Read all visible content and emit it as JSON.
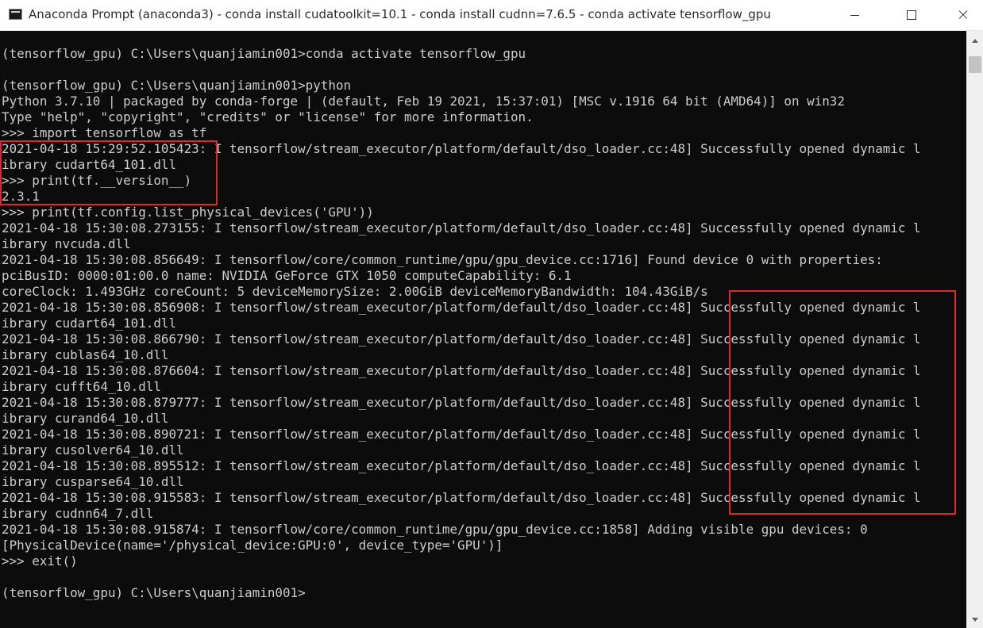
{
  "window": {
    "title": "Anaconda Prompt (anaconda3) - conda  install cudatoolkit=10.1 - conda  install cudnn=7.6.5 - conda  activate tensorflow_gpu",
    "app_icon": "console-icon",
    "controls": {
      "minimize": "minimize-icon",
      "maximize": "maximize-icon",
      "close": "close-icon"
    }
  },
  "console": {
    "background": "#0c0c0c",
    "foreground": "#cccccc",
    "lines": [
      "(tensorflow_gpu) C:\\Users\\quanjiamin001>conda activate tensorflow_gpu",
      "",
      "(tensorflow_gpu) C:\\Users\\quanjiamin001>python",
      "Python 3.7.10 | packaged by conda-forge | (default, Feb 19 2021, 15:37:01) [MSC v.1916 64 bit (AMD64)] on win32",
      "Type \"help\", \"copyright\", \"credits\" or \"license\" for more information.",
      ">>> import tensorflow as tf",
      "2021-04-18 15:29:52.105423: I tensorflow/stream_executor/platform/default/dso_loader.cc:48] Successfully opened dynamic l",
      "ibrary cudart64_101.dll",
      ">>> print(tf.__version__)",
      "2.3.1",
      ">>> print(tf.config.list_physical_devices('GPU'))",
      "2021-04-18 15:30:08.273155: I tensorflow/stream_executor/platform/default/dso_loader.cc:48] Successfully opened dynamic l",
      "ibrary nvcuda.dll",
      "2021-04-18 15:30:08.856649: I tensorflow/core/common_runtime/gpu/gpu_device.cc:1716] Found device 0 with properties:",
      "pciBusID: 0000:01:00.0 name: NVIDIA GeForce GTX 1050 computeCapability: 6.1",
      "coreClock: 1.493GHz coreCount: 5 deviceMemorySize: 2.00GiB deviceMemoryBandwidth: 104.43GiB/s",
      "2021-04-18 15:30:08.856908: I tensorflow/stream_executor/platform/default/dso_loader.cc:48] Successfully opened dynamic l",
      "ibrary cudart64_101.dll",
      "2021-04-18 15:30:08.866790: I tensorflow/stream_executor/platform/default/dso_loader.cc:48] Successfully opened dynamic l",
      "ibrary cublas64_10.dll",
      "2021-04-18 15:30:08.876604: I tensorflow/stream_executor/platform/default/dso_loader.cc:48] Successfully opened dynamic l",
      "ibrary cufft64_10.dll",
      "2021-04-18 15:30:08.879777: I tensorflow/stream_executor/platform/default/dso_loader.cc:48] Successfully opened dynamic l",
      "ibrary curand64_10.dll",
      "2021-04-18 15:30:08.890721: I tensorflow/stream_executor/platform/default/dso_loader.cc:48] Successfully opened dynamic l",
      "ibrary cusolver64_10.dll",
      "2021-04-18 15:30:08.895512: I tensorflow/stream_executor/platform/default/dso_loader.cc:48] Successfully opened dynamic l",
      "ibrary cusparse64_10.dll",
      "2021-04-18 15:30:08.915583: I tensorflow/stream_executor/platform/default/dso_loader.cc:48] Successfully opened dynamic l",
      "ibrary cudnn64_7.dll",
      "2021-04-18 15:30:08.915874: I tensorflow/core/common_runtime/gpu/gpu_device.cc:1858] Adding visible gpu devices: 0",
      "[PhysicalDevice(name='/physical_device:GPU:0', device_type='GPU')]",
      ">>> exit()",
      "",
      "(tensorflow_gpu) C:\\Users\\quanjiamin001>"
    ]
  },
  "annotations": {
    "highlight_color": "#e0272b"
  }
}
